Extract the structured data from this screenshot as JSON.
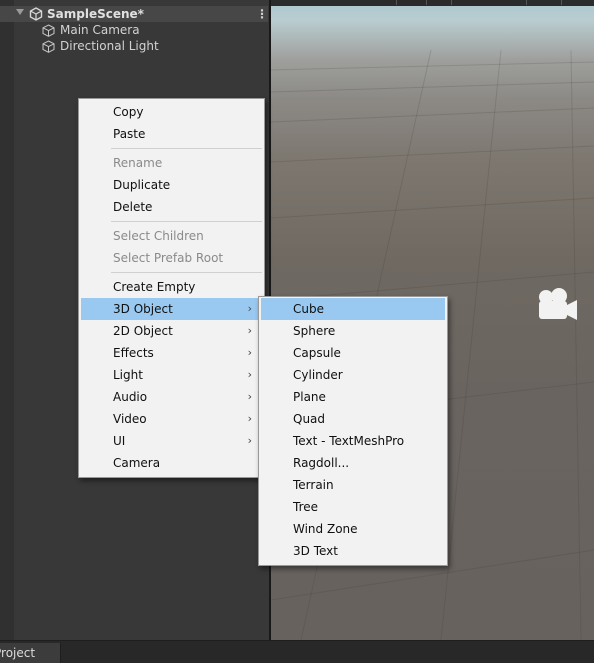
{
  "hierarchy": {
    "scene_name": "SampleScene*",
    "kebab": "⋮",
    "items": [
      {
        "label": "Main Camera"
      },
      {
        "label": "Directional Light"
      }
    ]
  },
  "context_menu": {
    "items": [
      {
        "label": "Copy",
        "enabled": true
      },
      {
        "label": "Paste",
        "enabled": true
      },
      {
        "label": "Rename",
        "enabled": false
      },
      {
        "label": "Duplicate",
        "enabled": true
      },
      {
        "label": "Delete",
        "enabled": true
      },
      {
        "label": "Select Children",
        "enabled": false
      },
      {
        "label": "Select Prefab Root",
        "enabled": false
      },
      {
        "label": "Create Empty",
        "enabled": true
      },
      {
        "label": "3D Object",
        "enabled": true,
        "highlighted": true,
        "submenu": true
      },
      {
        "label": "2D Object",
        "enabled": true,
        "submenu": true
      },
      {
        "label": "Effects",
        "enabled": true,
        "submenu": true
      },
      {
        "label": "Light",
        "enabled": true,
        "submenu": true
      },
      {
        "label": "Audio",
        "enabled": true,
        "submenu": true
      },
      {
        "label": "Video",
        "enabled": true,
        "submenu": true
      },
      {
        "label": "UI",
        "enabled": true,
        "submenu": true
      },
      {
        "label": "Camera",
        "enabled": true
      }
    ],
    "submenu_arrow": "›"
  },
  "submenu_3d_object": {
    "items": [
      {
        "label": "Cube",
        "highlighted": true
      },
      {
        "label": "Sphere"
      },
      {
        "label": "Capsule"
      },
      {
        "label": "Cylinder"
      },
      {
        "label": "Plane"
      },
      {
        "label": "Quad"
      },
      {
        "label": "Text - TextMeshPro"
      },
      {
        "label": "Ragdoll..."
      },
      {
        "label": "Terrain"
      },
      {
        "label": "Tree"
      },
      {
        "label": "Wind Zone"
      },
      {
        "label": "3D Text"
      }
    ]
  },
  "bottom_tabs": {
    "project_label": "Project"
  },
  "icons": {
    "scene": "unity-logo-icon",
    "gameobject": "cube-outline-icon",
    "scene_camera": "camera-gizmo-icon"
  },
  "colors": {
    "menu_bg": "#f2f2f2",
    "menu_highlight": "#99c9f0",
    "panel_bg": "#383838"
  }
}
